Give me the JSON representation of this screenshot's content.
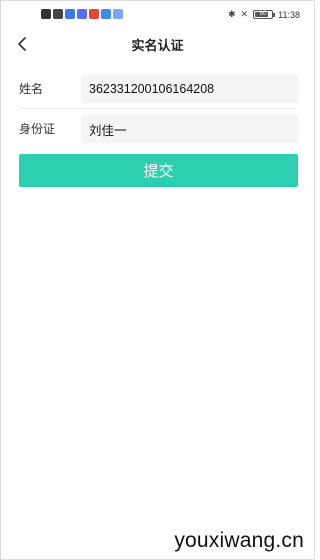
{
  "status_bar": {
    "time": "11:38",
    "battery_level": "80",
    "battery_fraction": 0.8,
    "left_icons": [
      {
        "name": "notification-b-icon",
        "color": "#333333"
      },
      {
        "name": "wifi-icon",
        "color": "#444444"
      },
      {
        "name": "app-notification-icon",
        "color": "#3c7be0"
      },
      {
        "name": "app-notification-icon",
        "color": "#5a6cf0"
      },
      {
        "name": "app-notification-icon",
        "color": "#e0483c"
      },
      {
        "name": "app-notification-icon",
        "color": "#3c8ee0"
      },
      {
        "name": "app-notification-icon",
        "color": "#7aa7f5"
      }
    ]
  },
  "header": {
    "title": "实名认证",
    "back_icon": "chevron-left-icon"
  },
  "form": {
    "name_label": "姓名",
    "name_value": "362331200106164208",
    "id_label": "身份证",
    "id_value": "刘佳一"
  },
  "submit": {
    "label": "提交",
    "color": "#2ecfb0"
  },
  "watermark": {
    "text": "youxiwang.cn"
  }
}
